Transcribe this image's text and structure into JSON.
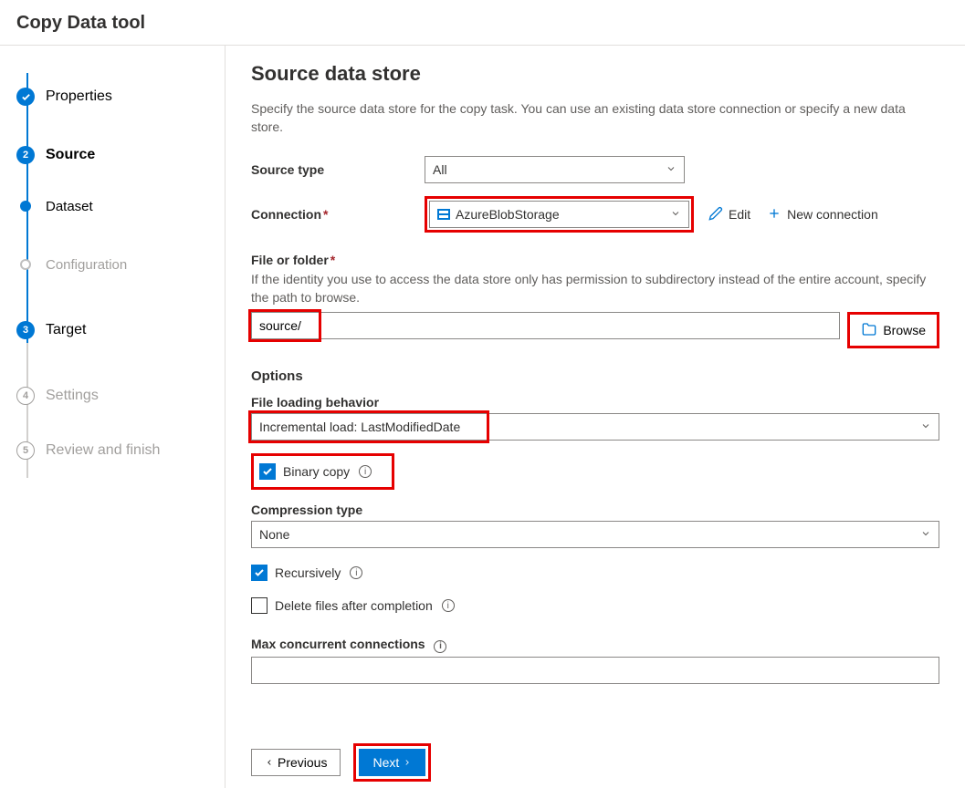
{
  "header": {
    "title": "Copy Data tool"
  },
  "steps": {
    "properties": "Properties",
    "source": "Source",
    "dataset": "Dataset",
    "configuration": "Configuration",
    "target": "Target",
    "settings": "Settings",
    "review": "Review and finish",
    "num_source": "2",
    "num_target": "3",
    "num_settings": "4",
    "num_review": "5"
  },
  "page": {
    "title": "Source data store",
    "description": "Specify the source data store for the copy task. You can use an existing data store connection or specify a new data store."
  },
  "form": {
    "source_type_label": "Source type",
    "source_type_value": "All",
    "connection_label": "Connection",
    "connection_value": "AzureBlobStorage",
    "edit": "Edit",
    "new_connection": "New connection",
    "file_folder_label": "File or folder",
    "file_folder_help": "If the identity you use to access the data store only has permission to subdirectory instead of the entire account, specify the path to browse.",
    "file_folder_value": "source/",
    "browse": "Browse",
    "options_heading": "Options",
    "file_loading_label": "File loading behavior",
    "file_loading_value": "Incremental load: LastModifiedDate",
    "binary_copy_label": "Binary copy",
    "compression_label": "Compression type",
    "compression_value": "None",
    "recursively_label": "Recursively",
    "delete_after_label": "Delete files after completion",
    "max_conn_label": "Max concurrent connections"
  },
  "footer": {
    "previous": "Previous",
    "next": "Next"
  }
}
